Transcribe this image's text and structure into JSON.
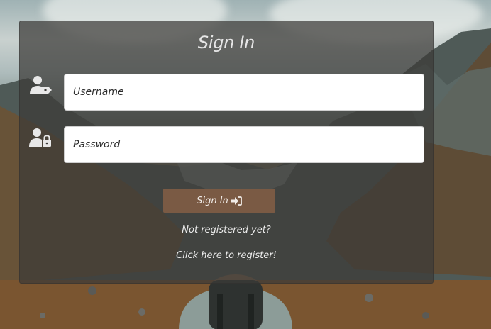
{
  "form": {
    "title": "Sign In",
    "username": {
      "placeholder": "Username",
      "value": "",
      "icon": "user-tag-icon"
    },
    "password": {
      "placeholder": "Password",
      "value": "",
      "icon": "user-lock-icon"
    },
    "submit": {
      "label": "Sign In",
      "icon": "sign-in-icon"
    },
    "not_registered_text": "Not registered yet?",
    "register_link_text": "Click here to register!"
  },
  "colors": {
    "panel_overlay": "#3c3a38",
    "button": "#7a5a44",
    "text": "#e6e6e6"
  }
}
